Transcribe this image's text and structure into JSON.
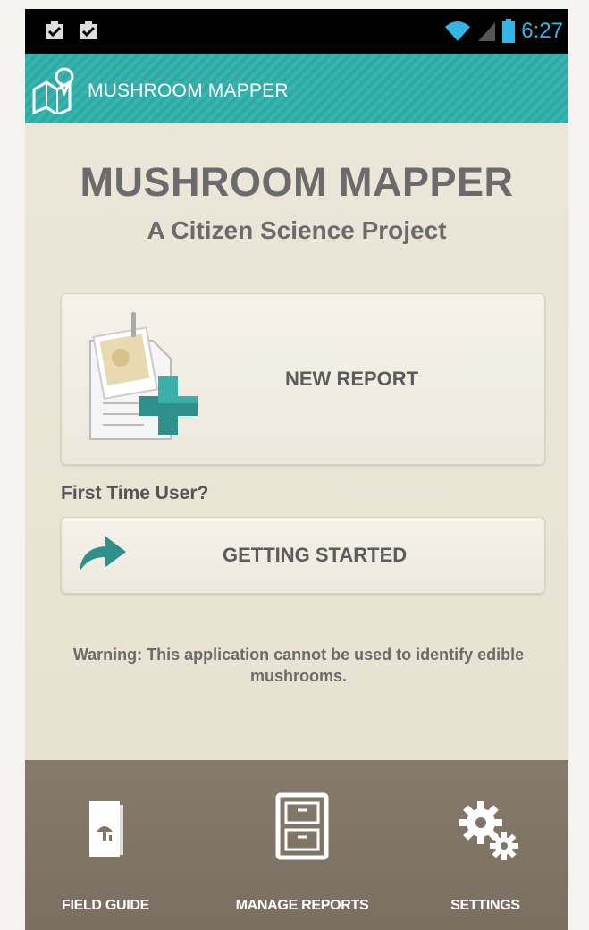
{
  "status_bar": {
    "notification_icons": [
      "clipboard-check-icon",
      "clipboard-check-icon"
    ],
    "wifi_icon": "wifi-icon",
    "signal_icon": "signal-icon",
    "battery_icon": "battery-icon",
    "time": "6:27",
    "accent_color": "#33b5e5"
  },
  "action_bar": {
    "title": "MUSHROOM MAPPER",
    "logo_icon": "map-pin-icon",
    "color": "#33aea8"
  },
  "main": {
    "title": "MUSHROOM MAPPER",
    "subtitle": "A Citizen Science Project",
    "new_report": {
      "label": "NEW REPORT",
      "icon": "new-report-icon"
    },
    "first_time_label": "First Time User?",
    "getting_started": {
      "label": "GETTING STARTED",
      "icon": "arrow-icon"
    },
    "warning": "Warning: This application cannot be used to identify edible mushrooms."
  },
  "bottom_nav": {
    "color": "#80766a",
    "tabs": [
      {
        "label": "FIELD GUIDE",
        "icon": "book-icon"
      },
      {
        "label": "MANAGE REPORTS",
        "icon": "file-cabinet-icon"
      },
      {
        "label": "SETTINGS",
        "icon": "gear-icon"
      }
    ]
  }
}
